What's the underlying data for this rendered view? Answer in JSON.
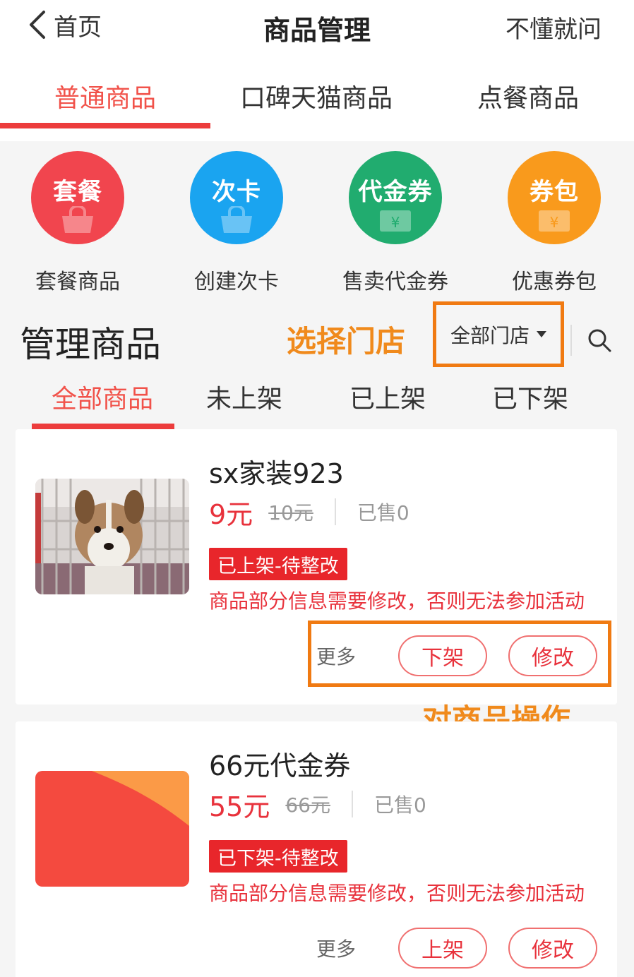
{
  "header": {
    "back_label": "首页",
    "title": "商品管理",
    "help": "不懂就问"
  },
  "top_tabs": [
    {
      "label": "普通商品",
      "active": true
    },
    {
      "label": "口碑天猫商品",
      "active": false
    },
    {
      "label": "点餐商品",
      "active": false
    }
  ],
  "shortcuts": [
    {
      "circle_text": "套餐",
      "label": "套餐商品",
      "color": "#f1454e",
      "icon": "bag-icon"
    },
    {
      "circle_text": "次卡",
      "label": "创建次卡",
      "color": "#1aa4f0",
      "icon": "bag-icon"
    },
    {
      "circle_text": "代金券",
      "label": "售卖代金券",
      "color": "#21ac6f",
      "icon": "coupon-icon"
    },
    {
      "circle_text": "券包",
      "label": "优惠券包",
      "color": "#f99a1c",
      "icon": "coupon-icon"
    }
  ],
  "manage": {
    "title": "管理商品",
    "annotation_store": "选择门店",
    "store_select": "全部门店",
    "annotation_actions": "对商品操作"
  },
  "status_tabs": [
    {
      "label": "全部商品",
      "active": true
    },
    {
      "label": "未上架",
      "active": false
    },
    {
      "label": "已上架",
      "active": false
    },
    {
      "label": "已下架",
      "active": false
    }
  ],
  "products": [
    {
      "name": "sx家装923",
      "price": "9元",
      "original_price": "10元",
      "sold": "已售0",
      "status": "已上架-待整改",
      "warning": "商品部分信息需要修改，否则无法参加活动",
      "more": "更多",
      "action_1": "下架",
      "action_2": "修改"
    },
    {
      "name": "66元代金券",
      "price": "55元",
      "original_price": "66元",
      "sold": "已售0",
      "status": "已下架-待整改",
      "warning": "商品部分信息需要修改，否则无法参加活动",
      "more": "更多",
      "action_1": "上架",
      "action_2": "修改"
    }
  ],
  "colors": {
    "accent_red": "#ec3c3c",
    "annotation_orange": "#f07a12"
  }
}
